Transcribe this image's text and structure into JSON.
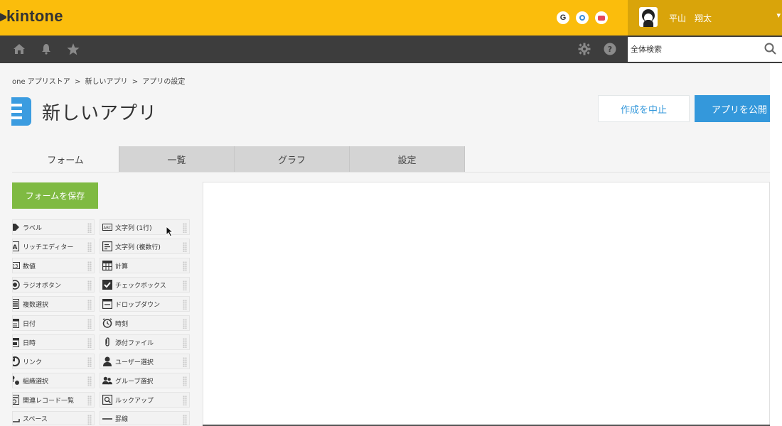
{
  "brand": {
    "logo_text": "kintone"
  },
  "header": {
    "circles": [
      "G",
      "",
      ""
    ],
    "user_name": "平山　翔太",
    "caret": "▾"
  },
  "nav": {
    "icons": [
      "home-icon",
      "bell-icon",
      "star-icon"
    ],
    "right_icons": [
      "gear-icon",
      "help-icon"
    ],
    "search_placeholder": "全体検索"
  },
  "breadcrumb": [
    "one アプリストア",
    ">",
    "新しいアプリ",
    ">",
    "アプリの設定"
  ],
  "app": {
    "title": "新しいアプリ"
  },
  "actions": {
    "cancel_label": "作成を中止",
    "publish_label": "アプリを公開"
  },
  "tabs": [
    {
      "label": "フォーム"
    },
    {
      "label": "一覧"
    },
    {
      "label": "グラフ"
    },
    {
      "label": "設定"
    }
  ],
  "form": {
    "save_label": "フォームを保存"
  },
  "palette": {
    "left": [
      "ラベル",
      "リッチエディター",
      "数値",
      "ラジオボタン",
      "複数選択",
      "日付",
      "日時",
      "リンク",
      "組織選択",
      "関連レコード一覧",
      "スペース"
    ],
    "right": [
      "文字列 (1行)",
      "文字列 (複数行)",
      "計算",
      "チェックボックス",
      "ドロップダウン",
      "時刻",
      "添付ファイル",
      "ユーザー選択",
      "グループ選択",
      "ルックアップ",
      "罫線"
    ]
  },
  "colors": {
    "topbar": "#fbbd0c",
    "navbar": "#3d3d3d",
    "accent_blue": "#3498db",
    "save_green": "#7fba42"
  }
}
